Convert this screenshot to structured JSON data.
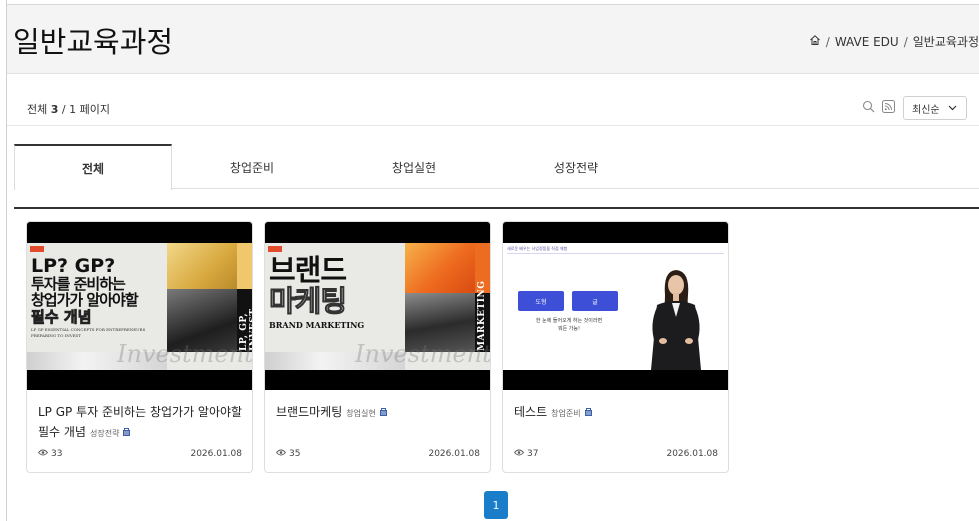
{
  "header": {
    "title": "일반교육과정",
    "breadcrumb": [
      "WAVE EDU",
      "일반교육과정"
    ]
  },
  "toolbar": {
    "count_prefix": "전체 ",
    "count_total": "3",
    "count_suffix": " / 1 페이지",
    "sort_label": "최신순"
  },
  "tabs": [
    {
      "label": "전체",
      "active": true
    },
    {
      "label": "창업준비",
      "active": false
    },
    {
      "label": "창업실현",
      "active": false
    },
    {
      "label": "성장전략",
      "active": false
    }
  ],
  "cards": [
    {
      "title": "LP GP 투자 준비하는 창업가가 알아야할 필수 개념",
      "category": "성장전략",
      "views": "33",
      "date": "2026.01.08",
      "thumb": {
        "headline_1": "LP? GP?",
        "headline_2": "투자를 준비하는",
        "headline_3": "창업가가 알아야할",
        "headline_4": "필수 개념",
        "subtitle": "LP GP ESSENTIAL CONCEPTS FOR ENTREPRENEURS",
        "subtitle_2": "PREPARING TO INVEST",
        "vertical": "LP, GP, INVEST",
        "script": "Investment"
      }
    },
    {
      "title": "브랜드마케팅",
      "category": "창업실현",
      "views": "35",
      "date": "2026.01.08",
      "thumb": {
        "headline_1": "브랜드",
        "headline_2": "마케팅",
        "subtitle": "BRAND MARKETING",
        "vertical": "MARKETING",
        "script": "Investment"
      }
    },
    {
      "title": "테스트",
      "category": "창업준비",
      "views": "37",
      "date": "2026.01.08",
      "thumb": {
        "header": "새로운 배우는 사업정품을 직접 체험",
        "button_1": "도형",
        "button_2": "글",
        "caption_1": "한 눈에 들어오게 하는 것이라면",
        "caption_2": "뭐든 가능!"
      }
    }
  ],
  "pagination": {
    "current": "1"
  },
  "colors": {
    "accent": "#1a7dc9",
    "header_bg": "#f4f4f4"
  }
}
